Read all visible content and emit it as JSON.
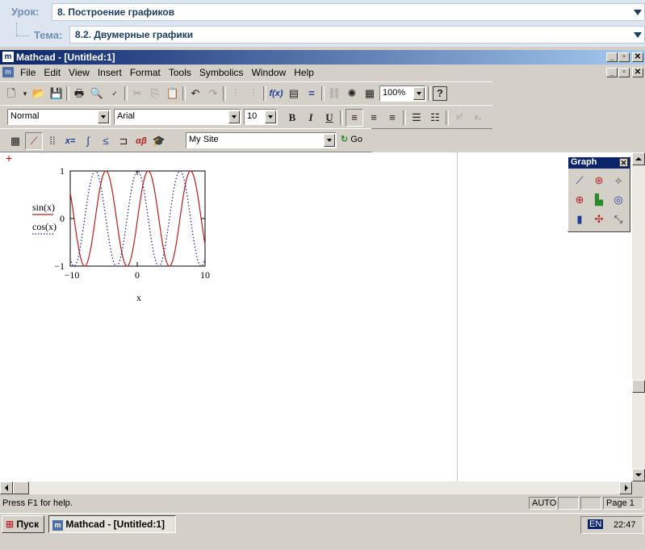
{
  "course": {
    "lesson_label": "Урок:",
    "lesson_value": "8. Построение графиков",
    "topic_label": "Тема:",
    "topic_value": "8.2. Двумерные графики"
  },
  "window": {
    "title": "Mathcad - [Untitled:1]",
    "controls": {
      "minimize": "_",
      "restore": "▫",
      "close": "✕"
    }
  },
  "menu": [
    "File",
    "Edit",
    "View",
    "Insert",
    "Format",
    "Tools",
    "Symbolics",
    "Window",
    "Help"
  ],
  "toolbar": {
    "zoom": "100%"
  },
  "format_bar": {
    "style": "Normal",
    "font": "Arial",
    "size": "10",
    "bold": "B",
    "italic": "I",
    "underline": "U"
  },
  "math_bar": {
    "resource": "My Site",
    "go_label": "Go"
  },
  "graph_palette": {
    "title": "Graph",
    "icons": [
      "xy-plot-icon",
      "polar-plot-icon",
      "add-line-icon",
      "trace-icon",
      "surface-plot-icon",
      "contour-plot-icon",
      "bar-plot-icon",
      "scatter-plot-icon",
      "vector-field-icon"
    ]
  },
  "plot": {
    "legend": [
      "sin(x)",
      "cos(x)"
    ],
    "xlabel": "x",
    "y_ticks": [
      "1",
      "0",
      "−1"
    ],
    "x_ticks": [
      "−10",
      "0",
      "10"
    ]
  },
  "chart_data": {
    "type": "line",
    "xlim": [
      -10,
      10
    ],
    "ylim": [
      -1,
      1
    ],
    "xlabel": "x",
    "series": [
      {
        "name": "sin(x)",
        "function": "sin(x)",
        "color": "#b02020",
        "style": "solid"
      },
      {
        "name": "cos(x)",
        "function": "cos(x)",
        "color": "#1a1a8c",
        "style": "dotted"
      }
    ],
    "x_ticks": [
      -10,
      0,
      10
    ],
    "y_ticks": [
      -1,
      0,
      1
    ]
  },
  "status": {
    "help": "Press F1 for help.",
    "mode": "AUTO",
    "page": "Page 1"
  },
  "taskbar": {
    "start": "Пуск",
    "task": "Mathcad - [Untitled:1]",
    "lang": "EN",
    "time": "22:47"
  }
}
